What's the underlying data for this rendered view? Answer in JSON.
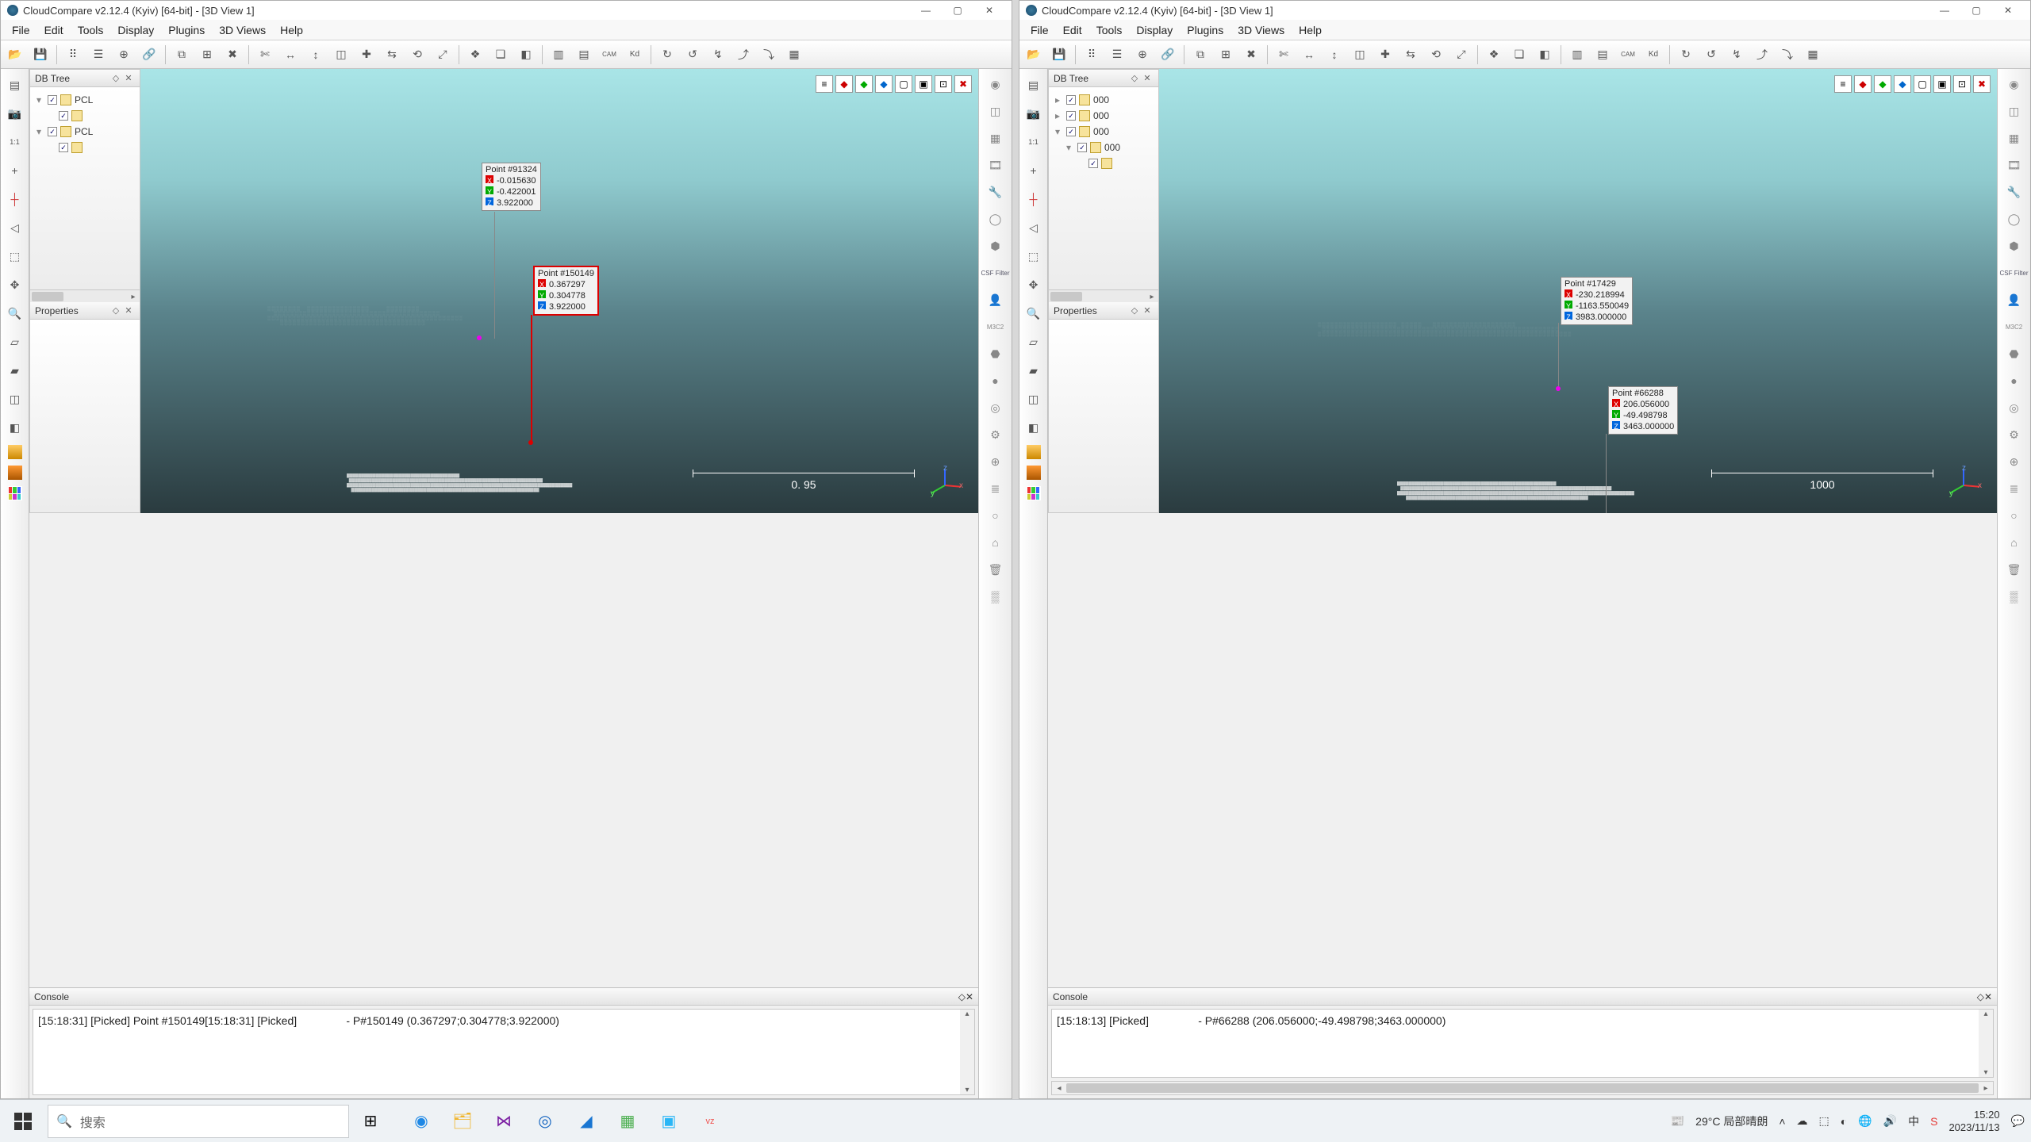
{
  "app": {
    "title": "CloudCompare v2.12.4 (Kyiv) [64-bit] - [3D View 1]"
  },
  "menus": [
    "File",
    "Edit",
    "Tools",
    "Display",
    "Plugins",
    "3D Views",
    "Help"
  ],
  "docks": {
    "dbtree": "DB Tree",
    "properties": "Properties",
    "console": "Console"
  },
  "left": {
    "tree": [
      "PCL",
      "PCL"
    ],
    "scalebar": "0. 95",
    "point_a": {
      "title": "Point #91324",
      "x": "-0.015630",
      "y": "-0.422001",
      "z": "3.922000"
    },
    "point_b": {
      "title": "Point #150149",
      "x": "0.367297",
      "y": "0.304778",
      "z": "3.922000"
    },
    "console": [
      "[15:18:31] [Picked] Point #150149",
      "[15:18:31] [Picked]                - P#150149 (0.367297;0.304778;3.922000)"
    ]
  },
  "right": {
    "tree": [
      "000",
      "000",
      "000",
      "000"
    ],
    "scalebar": "1000",
    "point_a": {
      "title": "Point #17429",
      "x": "-230.218994",
      "y": "-1163.550049",
      "z": "3983.000000"
    },
    "point_b": {
      "title": "Point #66288",
      "x": "206.056000",
      "y": "-49.498798",
      "z": "3463.000000"
    },
    "console": [
      "[15:18:13] [Picked]                - P#66288 (206.056000;-49.498798;3463.000000)"
    ]
  },
  "csf_label": "CSF Filter",
  "taskbar": {
    "search_placeholder": "搜索",
    "weather": "29°C  局部晴朗",
    "time": "15:20",
    "date": "2023/11/13"
  }
}
